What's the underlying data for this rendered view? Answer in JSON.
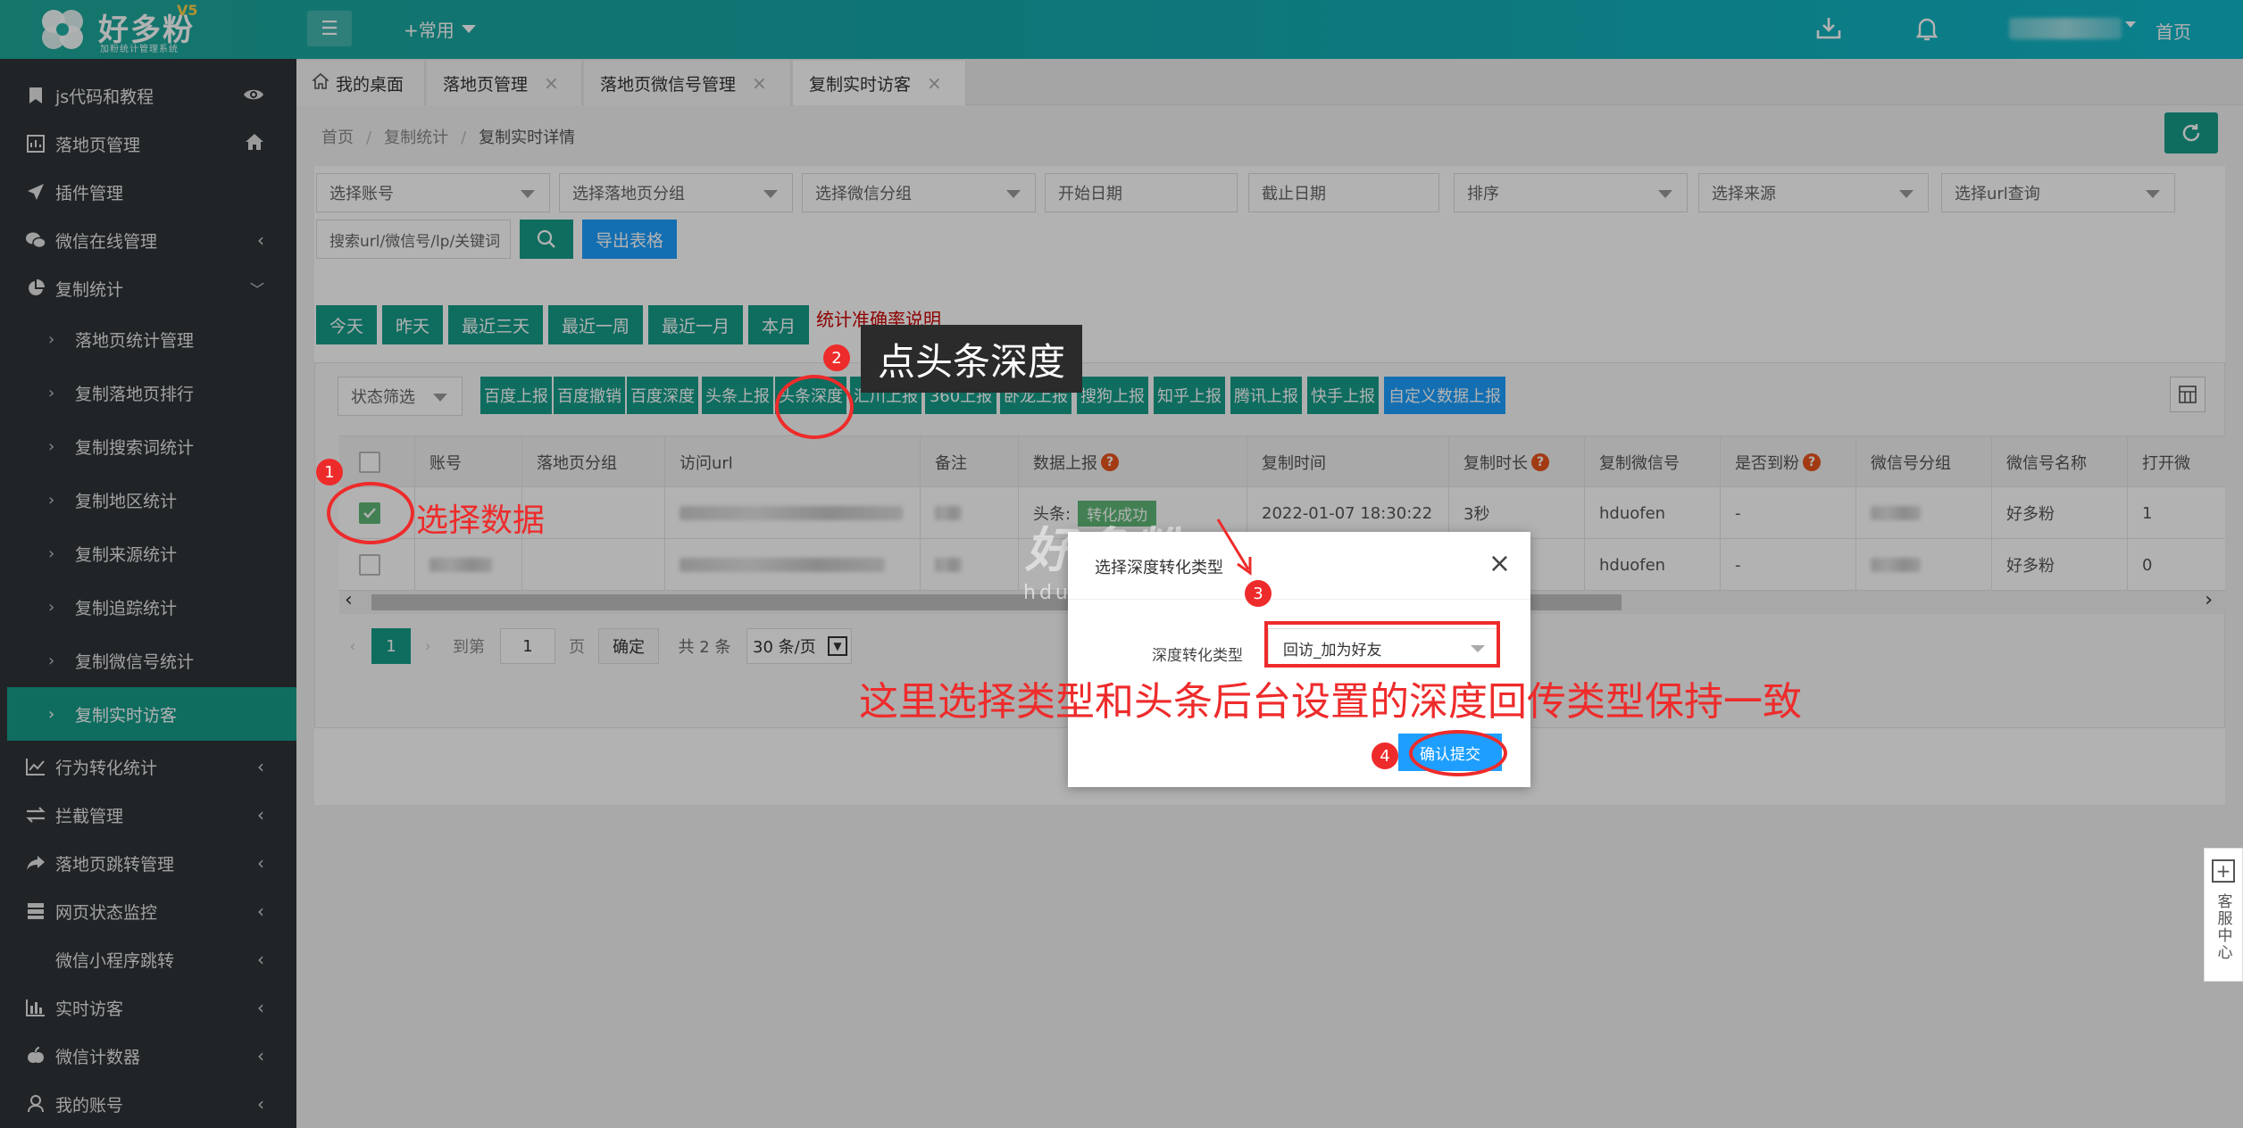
{
  "header": {
    "brand": "好多粉",
    "version": "V5",
    "subtitle": "加粉统计管理系统",
    "common_menu": "+常用",
    "home_link": "首页"
  },
  "sidebar": {
    "items": [
      {
        "label": "js代码和教程",
        "icon": "bookmark-icon",
        "right": "eye-icon"
      },
      {
        "label": "落地页管理",
        "icon": "chart-icon",
        "right": "home-icon"
      },
      {
        "label": "插件管理",
        "icon": "send-icon",
        "right": ""
      },
      {
        "label": "微信在线管理",
        "icon": "wechat-icon",
        "right": "chevron-left"
      },
      {
        "label": "复制统计",
        "icon": "pie-icon",
        "right": "chevron-down"
      }
    ],
    "sub_items": [
      {
        "label": "落地页统计管理"
      },
      {
        "label": "复制落地页排行"
      },
      {
        "label": "复制搜索词统计"
      },
      {
        "label": "复制地区统计"
      },
      {
        "label": "复制来源统计"
      },
      {
        "label": "复制追踪统计"
      },
      {
        "label": "复制微信号统计"
      },
      {
        "label": "复制实时访客"
      }
    ],
    "items_after": [
      {
        "label": "行为转化统计",
        "icon": "line-chart-icon"
      },
      {
        "label": "拦截管理",
        "icon": "exchange-icon"
      },
      {
        "label": "落地页跳转管理",
        "icon": "share-icon"
      },
      {
        "label": "网页状态监控",
        "icon": "server-icon"
      },
      {
        "label": "微信小程序跳转",
        "icon": ""
      },
      {
        "label": "实时访客",
        "icon": "bar-chart-icon"
      },
      {
        "label": "微信计数器",
        "icon": "apple-icon"
      },
      {
        "label": "我的账号",
        "icon": "user-icon"
      }
    ]
  },
  "tabs": [
    {
      "label": "我的桌面"
    },
    {
      "label": "落地页管理"
    },
    {
      "label": "落地页微信号管理"
    },
    {
      "label": "复制实时访客"
    }
  ],
  "breadcrumb": {
    "home": "首页",
    "parent": "复制统计",
    "current": "复制实时详情"
  },
  "filters": {
    "account": "选择账号",
    "page_group": "选择落地页分组",
    "wechat_group": "选择微信分组",
    "start_date": "开始日期",
    "end_date": "截止日期",
    "sort": "排序",
    "source": "选择来源",
    "url_query": "选择url查询",
    "search_placeholder": "搜索url/微信号/lp/关键词",
    "export": "导出表格"
  },
  "date_buttons": [
    "今天",
    "昨天",
    "最近三天",
    "最近一周",
    "最近一月",
    "本月"
  ],
  "accuracy_link": "统计准确率说明",
  "status_filter": "状态筛选",
  "report_buttons": [
    "百度上报",
    "百度撤销",
    "百度深度",
    "头条上报",
    "头条深度",
    "汇川上报",
    "360上报",
    "卧龙上报",
    "搜狗上报",
    "知乎上报",
    "腾讯上报",
    "快手上报",
    "自定义数据上报"
  ],
  "table": {
    "headers": [
      "账号",
      "落地页分组",
      "访问url",
      "备注",
      "数据上报",
      "复制时间",
      "复制时长",
      "复制微信号",
      "是否到粉",
      "微信号分组",
      "微信号名称",
      "打开微"
    ],
    "rows": [
      {
        "report_prefix": "头条:",
        "report_status": "转化成功",
        "time": "2022-01-07 18:30:22",
        "duration": "3秒",
        "wechat": "hduofen",
        "arrived": "-",
        "wx_name": "好多粉",
        "opened": "1"
      },
      {
        "report_prefix": "",
        "report_status": "",
        "time": "",
        "duration": "",
        "wechat": "hduofen",
        "arrived": "-",
        "wx_name": "好多粉",
        "opened": "0"
      }
    ]
  },
  "pager": {
    "current": "1",
    "goto_label": "到第",
    "goto_value": "1",
    "page_unit": "页",
    "confirm": "确定",
    "total": "共 2 条",
    "per_page": "30 条/页"
  },
  "modal": {
    "title": "选择深度转化类型",
    "field_label": "深度转化类型",
    "selected": "回访_加为好友",
    "submit": "确认提交"
  },
  "watermark": {
    "cn": "好多粉",
    "en": "hduofen.com"
  },
  "annotations": {
    "step1": "1",
    "step1_text": "选择数据",
    "step2": "2",
    "step2_text": "点头条深度",
    "step3": "3",
    "step4": "4",
    "instruction": "这里选择类型和头条后台设置的深度回传类型保持一致"
  },
  "float_service": {
    "label": "客服中心"
  },
  "colors": {
    "teal": "#169c8a",
    "blue": "#1e9fff",
    "sidebar": "#2f3437",
    "annotation": "#ee2b2b"
  }
}
